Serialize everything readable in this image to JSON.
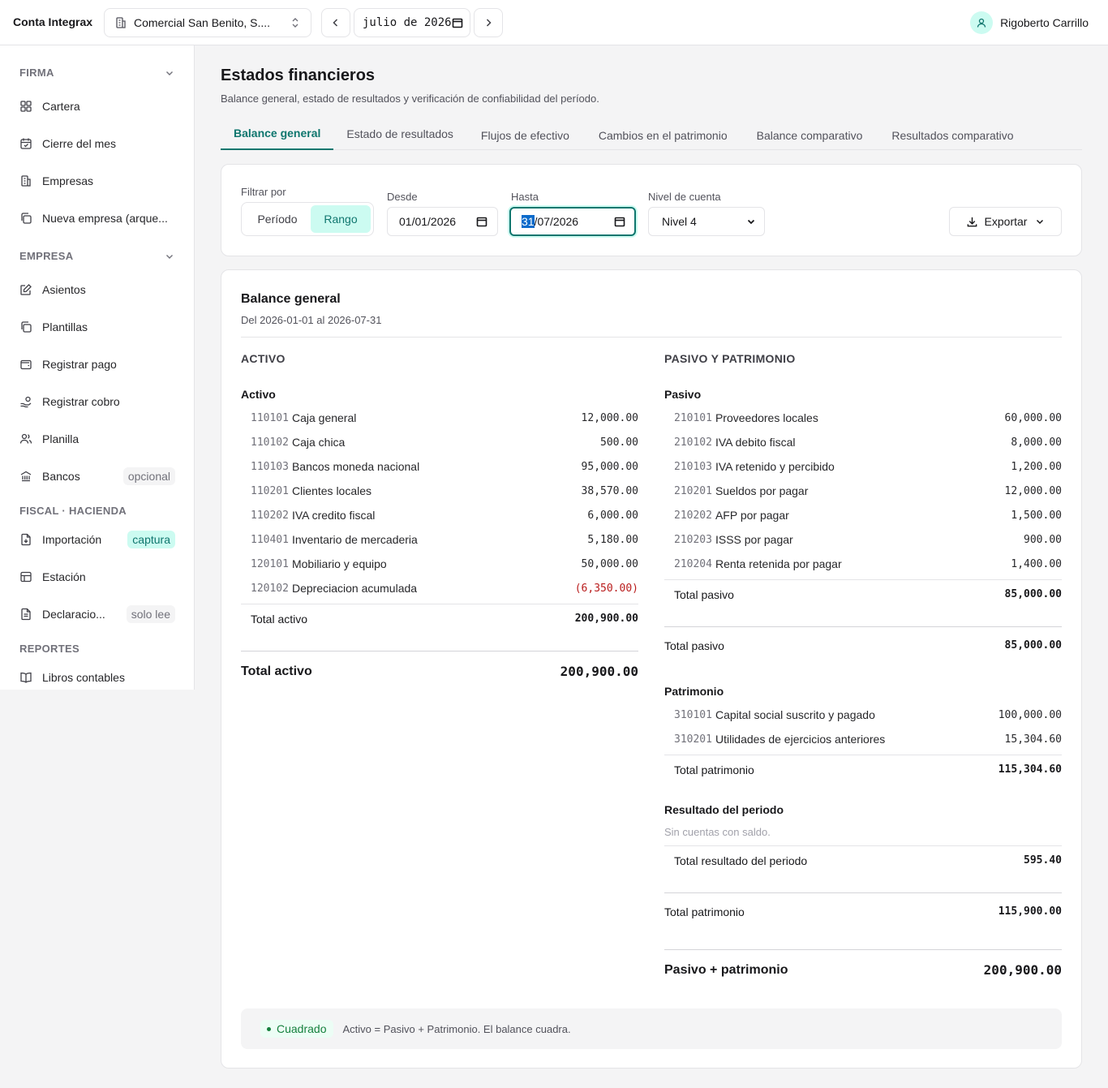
{
  "header": {
    "brand": "Conta Integrax",
    "company": "Comercial San Benito, S....",
    "month": "julio de 2026",
    "user_name": "Rigoberto Carrillo"
  },
  "sidebar": {
    "sections": [
      {
        "title": "FIRMA",
        "collapsible": true,
        "items": [
          {
            "label": "Cartera",
            "icon": "grid-icon"
          },
          {
            "label": "Cierre del mes",
            "icon": "calendar-check-icon"
          },
          {
            "label": "Empresas",
            "icon": "building-icon"
          },
          {
            "label": "Nueva empresa (arque...",
            "icon": "copy-icon"
          }
        ]
      },
      {
        "title": "EMPRESA",
        "collapsible": true,
        "items": [
          {
            "label": "Asientos",
            "icon": "edit-icon"
          },
          {
            "label": "Plantillas",
            "icon": "copy-icon"
          },
          {
            "label": "Registrar pago",
            "icon": "wallet-icon"
          },
          {
            "label": "Registrar cobro",
            "icon": "hand-coins-icon"
          },
          {
            "label": "Planilla",
            "icon": "users-icon"
          },
          {
            "label": "Bancos",
            "icon": "bank-icon",
            "badge": "opcional"
          }
        ]
      },
      {
        "title": "FISCAL · HACIENDA",
        "collapsible": false,
        "items": [
          {
            "label": "Importación",
            "icon": "file-import-icon",
            "badge": "captura"
          },
          {
            "label": "Estación",
            "icon": "table-icon"
          },
          {
            "label": "Declaracio...",
            "icon": "file-text-icon",
            "badge": "solo lee"
          }
        ]
      },
      {
        "title": "REPORTES",
        "collapsible": false,
        "items": [
          {
            "label": "Libros contables",
            "icon": "book-icon"
          }
        ]
      }
    ]
  },
  "page": {
    "title": "Estados financieros",
    "subtitle": "Balance general, estado de resultados y verificación de confiabilidad del período.",
    "tabs": [
      "Balance general",
      "Estado de resultados",
      "Flujos de efectivo",
      "Cambios en el patrimonio",
      "Balance comparativo",
      "Resultados comparativo"
    ],
    "active_tab": 0
  },
  "filters": {
    "filter_by_label": "Filtrar por",
    "period_option": "Período",
    "range_option": "Rango",
    "from_label": "Desde",
    "from_value": "01/01/2026",
    "to_label": "Hasta",
    "to_day_selected": "31",
    "to_value_rest": "/07/2026",
    "level_label": "Nivel de cuenta",
    "level_value": "Nivel 4",
    "export_label": "Exportar"
  },
  "report": {
    "title": "Balance general",
    "subtitle": "Del 2026-01-01 al 2026-07-31",
    "assets": {
      "heading": "ACTIVO",
      "group": "Activo",
      "rows": [
        {
          "code": "110101",
          "name": "Caja general",
          "amount": "12,000.00"
        },
        {
          "code": "110102",
          "name": "Caja chica",
          "amount": "500.00"
        },
        {
          "code": "110103",
          "name": "Bancos moneda nacional",
          "amount": "95,000.00"
        },
        {
          "code": "110201",
          "name": "Clientes locales",
          "amount": "38,570.00"
        },
        {
          "code": "110202",
          "name": "IVA credito fiscal",
          "amount": "6,000.00"
        },
        {
          "code": "110401",
          "name": "Inventario de mercaderia",
          "amount": "5,180.00"
        },
        {
          "code": "120101",
          "name": "Mobiliario y equipo",
          "amount": "50,000.00"
        },
        {
          "code": "120102",
          "name": "Depreciacion acumulada",
          "amount": "(6,350.00)",
          "negative": true
        }
      ],
      "subtotal_label": "Total activo",
      "subtotal_amount": "200,900.00",
      "total_label": "Total activo",
      "total_amount": "200,900.00"
    },
    "liabilities": {
      "heading": "PASIVO Y PATRIMONIO",
      "group": "Pasivo",
      "rows": [
        {
          "code": "210101",
          "name": "Proveedores locales",
          "amount": "60,000.00"
        },
        {
          "code": "210102",
          "name": "IVA debito fiscal",
          "amount": "8,000.00"
        },
        {
          "code": "210103",
          "name": "IVA retenido y percibido",
          "amount": "1,200.00"
        },
        {
          "code": "210201",
          "name": "Sueldos por pagar",
          "amount": "12,000.00"
        },
        {
          "code": "210202",
          "name": "AFP por pagar",
          "amount": "1,500.00"
        },
        {
          "code": "210203",
          "name": "ISSS por pagar",
          "amount": "900.00"
        },
        {
          "code": "210204",
          "name": "Renta retenida por pagar",
          "amount": "1,400.00"
        }
      ],
      "subtotal_label": "Total pasivo",
      "subtotal_amount": "85,000.00",
      "total_label": "Total pasivo",
      "total_amount": "85,000.00"
    },
    "equity": {
      "group": "Patrimonio",
      "rows": [
        {
          "code": "310101",
          "name": "Capital social suscrito y pagado",
          "amount": "100,000.00"
        },
        {
          "code": "310201",
          "name": "Utilidades de ejercicios anteriores",
          "amount": "15,304.60"
        }
      ],
      "subtotal_label": "Total patrimonio",
      "subtotal_amount": "115,304.60",
      "result_group": "Resultado del periodo",
      "result_empty": "Sin cuentas con saldo.",
      "result_subtotal_label": "Total resultado del periodo",
      "result_subtotal_amount": "595.40",
      "total_label": "Total patrimonio",
      "total_amount": "115,900.00"
    },
    "grand_total_label": "Pasivo + patrimonio",
    "grand_total_amount": "200,900.00",
    "status_badge": "Cuadrado",
    "status_message": "Activo = Pasivo + Patrimonio. El balance cuadra."
  },
  "colors": {
    "accent": "#0f766e",
    "accent_soft": "#ccfbf1",
    "negative": "#b91c1c",
    "success": "#15803d"
  }
}
